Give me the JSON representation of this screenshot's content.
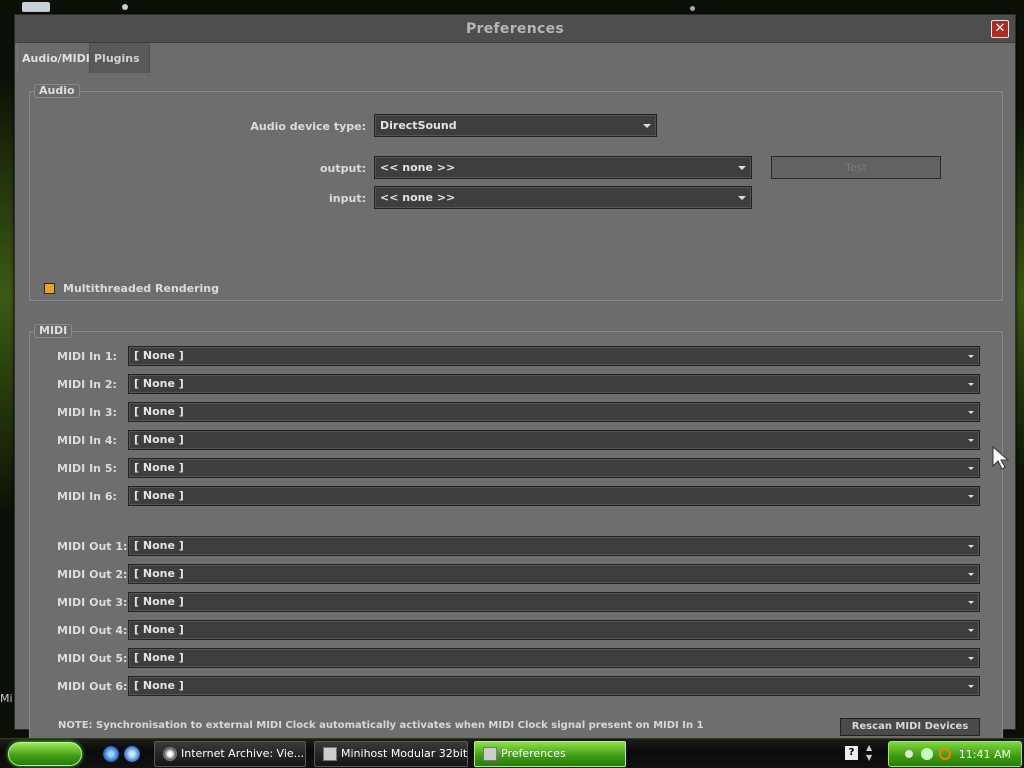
{
  "window": {
    "title": "Preferences",
    "close_glyph": "✕"
  },
  "tabs": [
    {
      "label": "Audio/MIDI",
      "active": true
    },
    {
      "label": "Plugins",
      "active": false
    }
  ],
  "audio": {
    "legend": "Audio",
    "device_type_label": "Audio device type:",
    "device_type_value": "DirectSound",
    "output_label": "output:",
    "output_value": "<< none >>",
    "input_label": "input:",
    "input_value": "<< none >>",
    "test_button": "Test",
    "multithreaded_label": "Multithreaded Rendering",
    "multithreaded_checked": true
  },
  "midi": {
    "legend": "MIDI",
    "inputs": [
      {
        "label": "MIDI In 1:",
        "value": "[ None ]"
      },
      {
        "label": "MIDI In 2:",
        "value": "[ None ]"
      },
      {
        "label": "MIDI In 3:",
        "value": "[ None ]"
      },
      {
        "label": "MIDI In 4:",
        "value": "[ None ]"
      },
      {
        "label": "MIDI In 5:",
        "value": "[ None ]"
      },
      {
        "label": "MIDI In 6:",
        "value": "[ None ]"
      }
    ],
    "outputs": [
      {
        "label": "MIDI Out 1:",
        "value": "[ None ]"
      },
      {
        "label": "MIDI Out 2:",
        "value": "[ None ]"
      },
      {
        "label": "MIDI Out 3:",
        "value": "[ None ]"
      },
      {
        "label": "MIDI Out 4:",
        "value": "[ None ]"
      },
      {
        "label": "MIDI Out 5:",
        "value": "[ None ]"
      },
      {
        "label": "MIDI Out 6:",
        "value": "[ None ]"
      }
    ],
    "note": "NOTE: Synchronisation to external MIDI Clock automatically activates when MIDI Clock signal present on MIDI In 1",
    "rescan_button": "Rescan MIDI Devices"
  },
  "taskbar": {
    "tasks": [
      {
        "label": "Internet Archive: Vie..."
      },
      {
        "label": "Minihost Modular 32bit"
      },
      {
        "label": "Preferences"
      }
    ],
    "help_glyph": "?",
    "clock": "11:41 AM"
  },
  "desktop": {
    "edge_text": "Mi"
  },
  "colors": {
    "window_bg": "#6c6c6c",
    "select_bg": "#3e3e3e",
    "checkbox": "#e6a61e",
    "close_red": "#b22a22",
    "taskbar_green": "#3c9a12"
  }
}
